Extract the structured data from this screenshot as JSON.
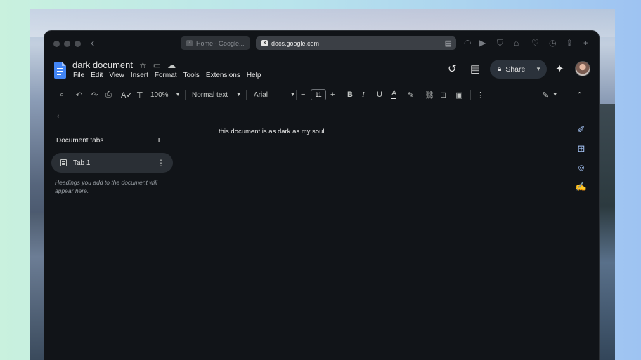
{
  "browser": {
    "tabs": [
      {
        "label": "Home - Google...",
        "active": false
      },
      {
        "label": "docs.google.com",
        "active": true
      }
    ],
    "icons": [
      "back-chevron-icon",
      "reader-icon",
      "rss-icon",
      "forward-media-icon",
      "shield-icon",
      "rocket-icon",
      "pocket-icon",
      "clock-icon",
      "share-icon",
      "new-tab-icon"
    ]
  },
  "doc": {
    "title": "dark document",
    "menu": [
      "File",
      "Edit",
      "View",
      "Insert",
      "Format",
      "Tools",
      "Extensions",
      "Help"
    ],
    "share_label": "Share"
  },
  "toolbar": {
    "zoom": "100%",
    "style": "Normal text",
    "font": "Arial",
    "font_size": "11"
  },
  "sidebar": {
    "heading": "Document tabs",
    "tab_label": "Tab 1",
    "hint": "Headings you add to the document will appear here."
  },
  "body": {
    "text": "this document is as dark as my soul"
  },
  "colors": {
    "window_bg": "#111418",
    "docs_blue": "#4285f4",
    "accent_light_blue": "#a8c7fa"
  }
}
